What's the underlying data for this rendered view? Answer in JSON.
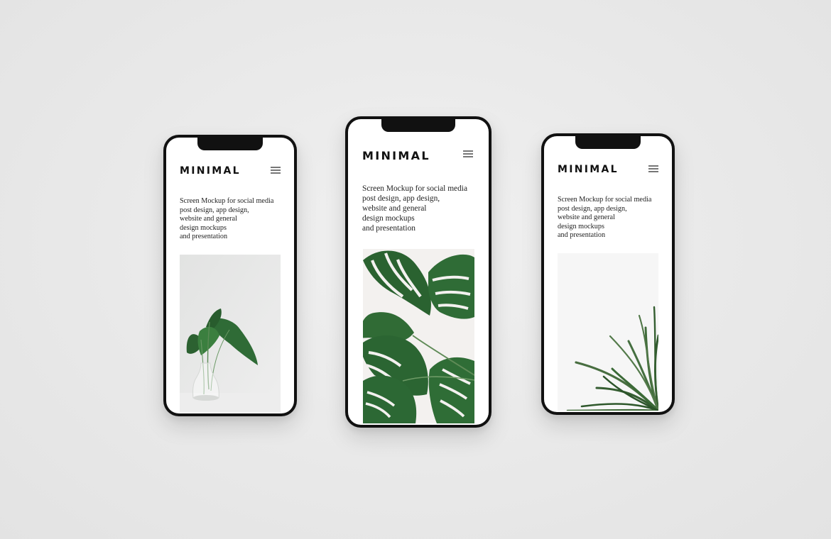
{
  "screens": [
    {
      "brand": "MINIMAL",
      "menu_icon": "hamburger-menu-icon",
      "copy_lines": [
        "Screen Mockup for social media",
        "post design, app design,",
        "website and general",
        "design mockups",
        "and presentation"
      ],
      "image": "vase-plant-image"
    },
    {
      "brand": "MINIMAL",
      "menu_icon": "hamburger-menu-icon",
      "copy_lines": [
        "Screen Mockup for social media",
        "post design, app design,",
        "website and general",
        "design mockups",
        "and presentation"
      ],
      "image": "monstera-leaves-image"
    },
    {
      "brand": "MINIMAL",
      "menu_icon": "hamburger-menu-icon",
      "copy_lines": [
        "Screen Mockup for social media",
        "post design, app design,",
        "website and general",
        "design mockups",
        "and presentation"
      ],
      "image": "palm-fronds-image"
    }
  ],
  "colors": {
    "background": "#e9e9e9",
    "phone_frame": "#111111",
    "screen": "#ffffff",
    "leaf_green": "#2f6b36"
  }
}
